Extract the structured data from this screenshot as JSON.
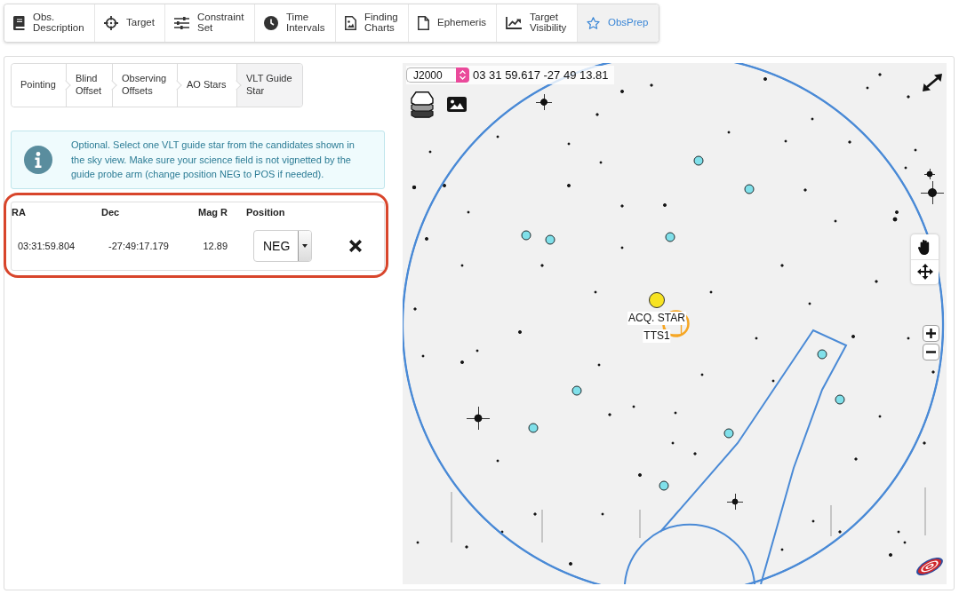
{
  "tabs": [
    {
      "label": "Obs. Description",
      "selected": false
    },
    {
      "label": "Target",
      "selected": false
    },
    {
      "label": "Constraint Set",
      "selected": false
    },
    {
      "label": "Time Intervals",
      "selected": false
    },
    {
      "label": "Finding Charts",
      "selected": false
    },
    {
      "label": "Ephemeris",
      "selected": false
    },
    {
      "label": "Target Visibility",
      "selected": false
    },
    {
      "label": "ObsPrep",
      "selected": true
    }
  ],
  "steps": [
    {
      "label": "Pointing",
      "selected": false
    },
    {
      "label": "Blind Offset",
      "selected": false
    },
    {
      "label": "Observing Offsets",
      "selected": false
    },
    {
      "label": "AO Stars",
      "selected": false
    },
    {
      "label": "VLT Guide Star",
      "selected": true
    }
  ],
  "info": {
    "text": "Optional. Select one VLT guide star from the candidates shown in the sky view. Make sure your science field is not vignetted by the guide probe arm (change position NEG to POS if needed)."
  },
  "guide_star_table": {
    "highlighted": true,
    "columns": [
      "RA",
      "Dec",
      "Mag R",
      "Position"
    ],
    "rows": [
      {
        "ra": "03:31:59.804",
        "dec": "-27:49:17.179",
        "mag_r": "12.89",
        "position": "NEG"
      }
    ]
  },
  "sky_view": {
    "frame": "J2000",
    "coordinates": "03 31 59.617 -27 49 13.81",
    "labels": [
      "ACQ. STAR",
      "TTS1"
    ]
  }
}
